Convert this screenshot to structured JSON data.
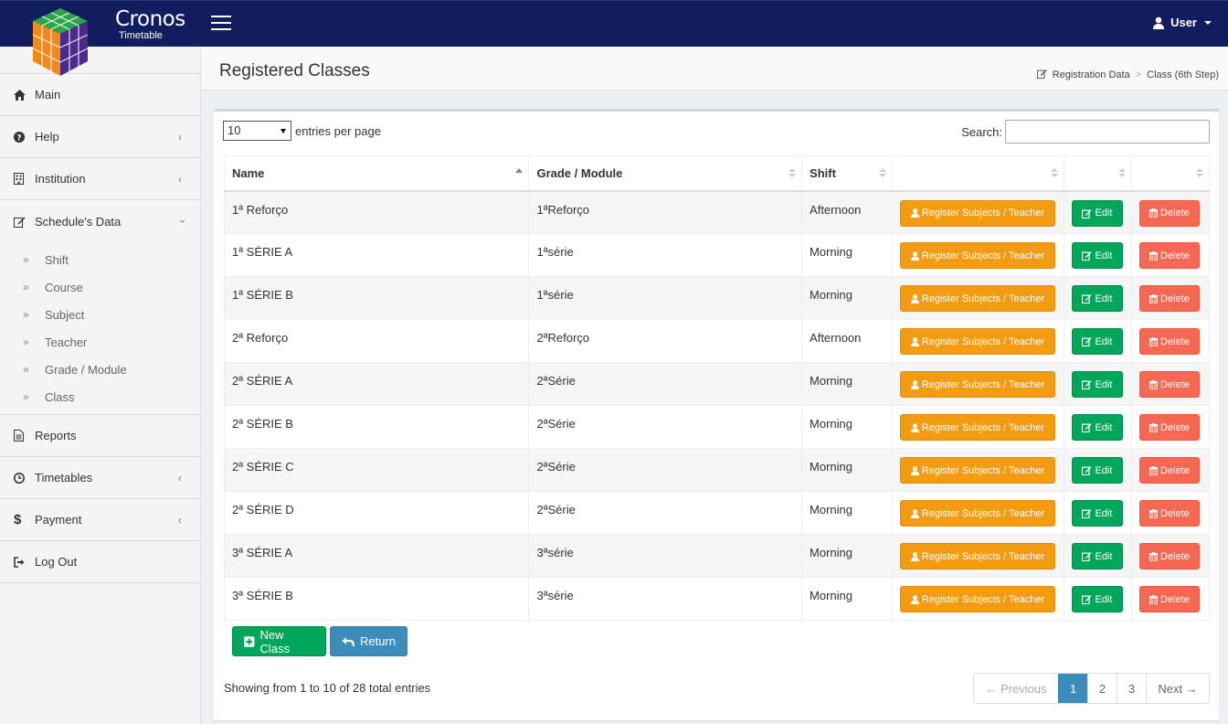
{
  "brand": {
    "title": "Cronos",
    "subtitle": "Timetable"
  },
  "user": {
    "label": "User"
  },
  "sidebar": {
    "items": [
      {
        "label": "Main",
        "icon": "home-icon"
      },
      {
        "label": "Help",
        "icon": "question-circle-icon"
      },
      {
        "label": "Institution",
        "icon": "building-icon"
      },
      {
        "label": "Schedule's Data",
        "icon": "edit-icon"
      }
    ],
    "subitems": [
      "Shift",
      "Course",
      "Subject",
      "Teacher",
      "Grade / Module",
      "Class"
    ],
    "bottom_items": [
      {
        "label": "Reports",
        "icon": "file-text-icon"
      },
      {
        "label": "Timetables",
        "icon": "clock-icon"
      },
      {
        "label": "Payment",
        "icon": "dollar-icon"
      },
      {
        "label": "Log Out",
        "icon": "sign-out-icon"
      }
    ]
  },
  "page": {
    "title": "Registered Classes",
    "breadcrumb": [
      "Registration Data",
      "Class (6th Step)"
    ]
  },
  "table_controls": {
    "length_value": "10",
    "length_label": "entries per page",
    "search_label": "Search:",
    "search_value": ""
  },
  "table": {
    "headers": [
      "Name",
      "Grade / Module",
      "Shift"
    ],
    "rows": [
      {
        "name": "1ª Reforço",
        "grade": "1ªReforço",
        "shift": "Afternoon"
      },
      {
        "name": "1ª SÉRIE A",
        "grade": "1ªsérie",
        "shift": "Morning"
      },
      {
        "name": "1ª SÉRIE B",
        "grade": "1ªsérie",
        "shift": "Morning"
      },
      {
        "name": "2ª Reforço",
        "grade": "2ªReforço",
        "shift": "Afternoon"
      },
      {
        "name": "2ª SÉRIE A",
        "grade": "2ªSérie",
        "shift": "Morning"
      },
      {
        "name": "2ª SÉRIE B",
        "grade": "2ªSérie",
        "shift": "Morning"
      },
      {
        "name": "2ª SÉRIE C",
        "grade": "2ªSérie",
        "shift": "Morning"
      },
      {
        "name": "2ª SÉRIE D",
        "grade": "2ªSérie",
        "shift": "Morning"
      },
      {
        "name": "3ª SÉRIE A",
        "grade": "3ªsérie",
        "shift": "Morning"
      },
      {
        "name": "3ª SÉRIE B",
        "grade": "3ªsérie",
        "shift": "Morning"
      }
    ],
    "row_buttons": {
      "register": "Register Subjects / Teacher",
      "edit": "Edit",
      "delete": "Delete"
    }
  },
  "actions": {
    "new_class": "New Class",
    "return": "Return"
  },
  "footer": {
    "info": "Showing from 1 to 10 of 28 total entries",
    "pagination": {
      "previous": "← Previous",
      "pages": [
        "1",
        "2",
        "3"
      ],
      "active": "1",
      "next": "Next →"
    }
  },
  "colors": {
    "topbar": "#111d5e",
    "orange": "#f39c12",
    "green": "#00a65a",
    "red": "#f56954",
    "blue": "#3c8dbc"
  }
}
